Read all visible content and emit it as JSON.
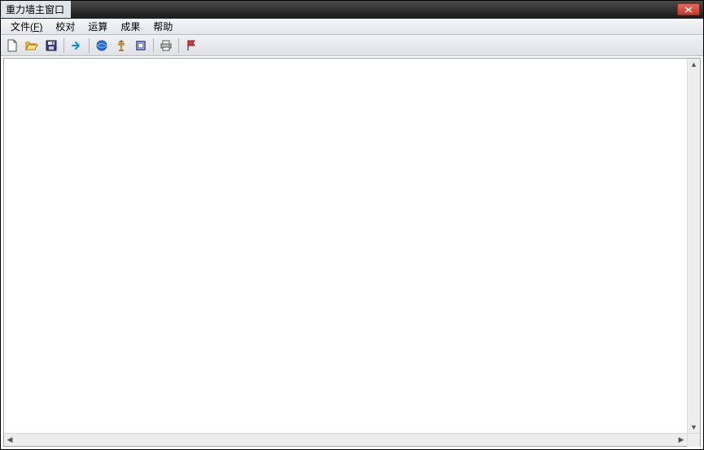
{
  "window": {
    "title": "重力墙主窗口"
  },
  "menu": {
    "items": [
      {
        "label": "文件",
        "accel": "(F)"
      },
      {
        "label": "校对",
        "accel": ""
      },
      {
        "label": "运算",
        "accel": ""
      },
      {
        "label": "成果",
        "accel": ""
      },
      {
        "label": "帮助",
        "accel": ""
      }
    ]
  },
  "toolbar": {
    "icons": {
      "new": "new-file-icon",
      "open": "open-folder-icon",
      "save": "save-disk-icon",
      "go": "arrow-right-icon",
      "globe": "globe-icon",
      "structure": "structure-icon",
      "section": "section-icon",
      "print": "printer-icon",
      "flag": "flag-icon"
    }
  }
}
